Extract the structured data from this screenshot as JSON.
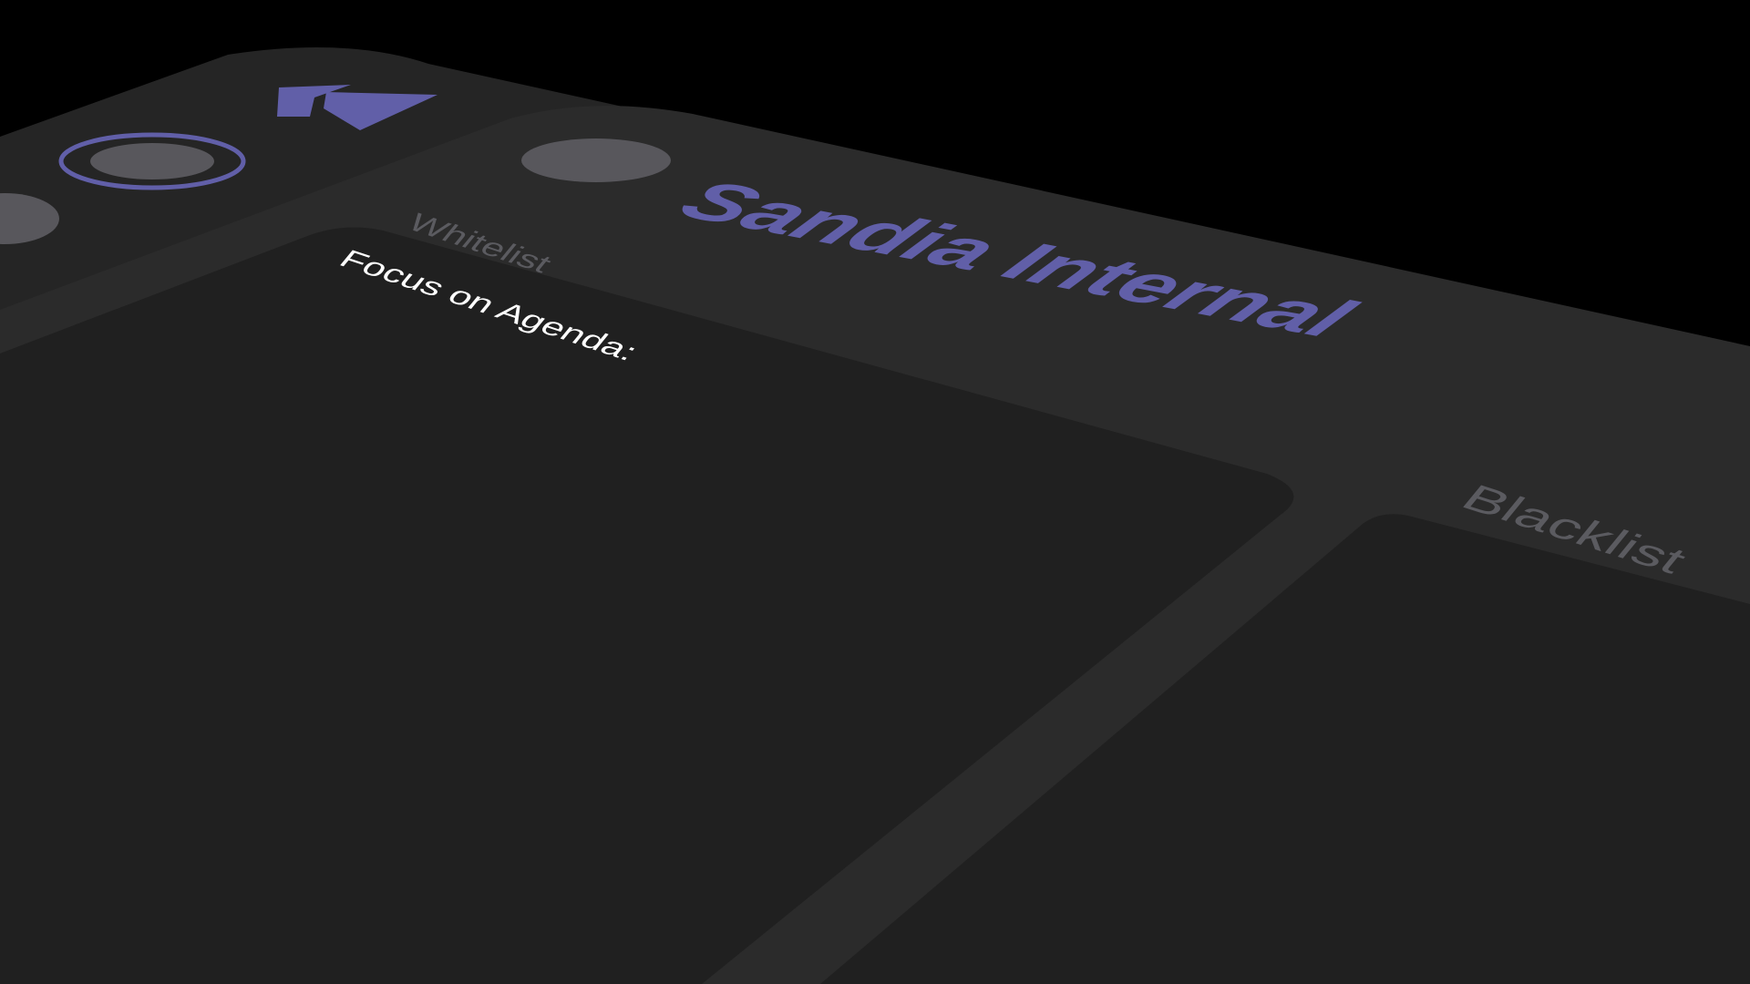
{
  "app": {
    "title": "Sandia Internal"
  },
  "sidebar": {
    "back_icon": "double-chevron-left-icon",
    "active_indicator_icon": "ring-dot-icon",
    "inactive_indicator_icon": "dot-icon"
  },
  "header": {
    "status_icon": "dot-icon",
    "title": "Sandia Internal"
  },
  "whitelist": {
    "label": "Whitelist",
    "text": "Focus on Agenda:"
  },
  "blacklist": {
    "label": "Blacklist",
    "text": ""
  },
  "colors": {
    "background": "#000000",
    "panel": "#2b2b2b",
    "panel_edge": "#252525",
    "card": "#202020",
    "accent": "#615fa8",
    "dot": "#58575c",
    "label_muted": "#5b5b60",
    "text": "#ffffff"
  }
}
